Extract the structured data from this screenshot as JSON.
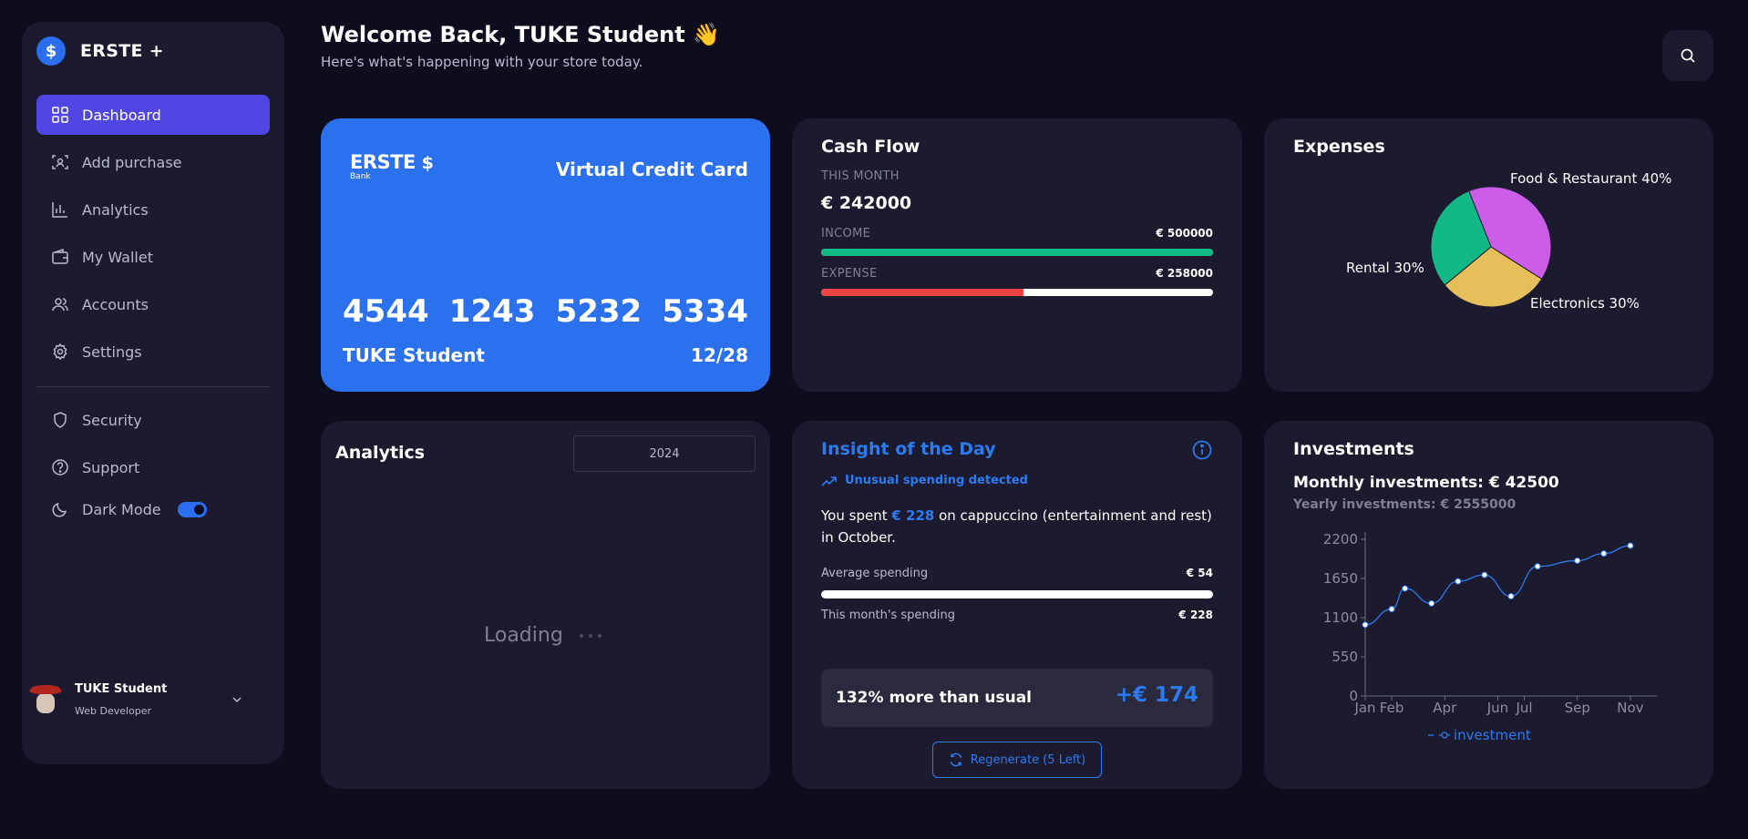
{
  "brand": {
    "name": "ERSTE +",
    "logo_glyph": "$"
  },
  "sidebar": {
    "items": [
      {
        "label": "Dashboard",
        "icon": "dashboard-icon",
        "active": true
      },
      {
        "label": "Add purchase",
        "icon": "scan-icon"
      },
      {
        "label": "Analytics",
        "icon": "bar-chart-icon"
      },
      {
        "label": "My Wallet",
        "icon": "wallet-icon"
      },
      {
        "label": "Accounts",
        "icon": "users-icon"
      },
      {
        "label": "Settings",
        "icon": "gear-icon"
      }
    ],
    "secondary": [
      {
        "label": "Security",
        "icon": "shield-icon"
      },
      {
        "label": "Support",
        "icon": "help-icon"
      }
    ],
    "dark_mode": {
      "label": "Dark Mode",
      "enabled": true
    }
  },
  "profile": {
    "name": "TUKE Student",
    "role": "Web Developer"
  },
  "header": {
    "welcome": "Welcome Back, TUKE Student 👋",
    "subtitle": "Here's what's happening with your store today."
  },
  "credit_card": {
    "bank_logo": "ERSTE",
    "bank_sub": "Bank",
    "title": "Virtual Credit Card",
    "numbers": [
      "4544",
      "1243",
      "5232",
      "5334"
    ],
    "holder": "TUKE Student",
    "expiry": "12/28"
  },
  "cash_flow": {
    "title": "Cash Flow",
    "period_label": "THIS MONTH",
    "total": "€ 242000",
    "income_label": "INCOME",
    "income_value": "€ 500000",
    "income_fraction": 1.0,
    "expense_label": "EXPENSE",
    "expense_value": "€ 258000",
    "expense_fraction": 0.516,
    "colors": {
      "income": "#10b981",
      "expense": "#ef4444"
    }
  },
  "expenses": {
    "title": "Expenses",
    "labels": [
      "Food & Restaurant 40%",
      "Electronics 30%",
      "Rental 30%"
    ]
  },
  "analytics": {
    "title": "Analytics",
    "year": "2024",
    "loading": "Loading"
  },
  "insight": {
    "title": "Insight of the Day",
    "alert": "Unusual spending detected",
    "text_before": "You spent ",
    "text_amount": "€ 228",
    "text_after": " on cappuccino (entertainment and rest) in October.",
    "avg_label": "Average spending",
    "avg_value": "€ 54",
    "month_label": "This month's spending",
    "month_value": "€ 228",
    "more_text": "132% more than usual",
    "more_value": "+€ 174",
    "regen_label": "Regenerate (5 Left)"
  },
  "investments": {
    "title": "Investments",
    "monthly": "Monthly investments: € 42500",
    "yearly": "Yearly investments: € 2555000"
  },
  "chart_data": [
    {
      "type": "pie",
      "title": "Expenses",
      "categories": [
        "Food & Restaurant",
        "Electronics",
        "Rental"
      ],
      "values": [
        40,
        30,
        30
      ],
      "colors": [
        "#cc5de8",
        "#e6be5a",
        "#12b886"
      ]
    },
    {
      "type": "line",
      "title": "Investments",
      "x_ticks": [
        "Jan",
        "Feb",
        "Apr",
        "Jun",
        "Jul",
        "Sep",
        "Nov"
      ],
      "y_ticks": [
        0,
        550,
        1100,
        1650,
        2200
      ],
      "ylim": [
        0,
        2200
      ],
      "xlim": [
        1,
        12
      ],
      "grid": false,
      "legend_position": "bottom",
      "series": [
        {
          "name": "investment",
          "color": "#2b7bf0",
          "points": [
            {
              "x": 1,
              "y": 1000
            },
            {
              "x": 2,
              "y": 1220
            },
            {
              "x": 2.5,
              "y": 1510
            },
            {
              "x": 3.5,
              "y": 1300
            },
            {
              "x": 4.5,
              "y": 1610
            },
            {
              "x": 5.5,
              "y": 1700
            },
            {
              "x": 6.5,
              "y": 1400
            },
            {
              "x": 7.5,
              "y": 1820
            },
            {
              "x": 9,
              "y": 1900
            },
            {
              "x": 10,
              "y": 2000
            },
            {
              "x": 11,
              "y": 2110
            }
          ]
        }
      ]
    }
  ]
}
